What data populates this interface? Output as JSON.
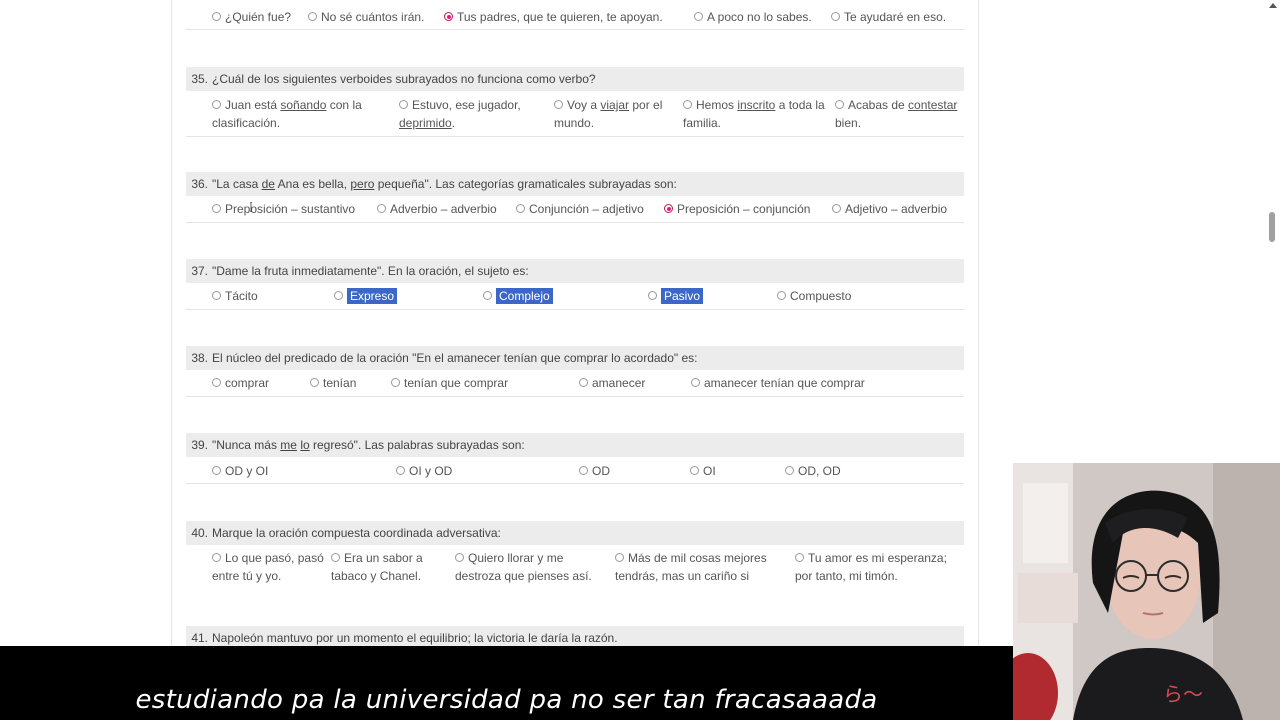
{
  "questions": [
    {
      "number": "",
      "text": "",
      "options": [
        {
          "label": "¿Quién fue?",
          "checked": false
        },
        {
          "label": "No sé cuántos irán.",
          "checked": false
        },
        {
          "label": "Tus padres, que te quieren, te apoyan.",
          "checked": true
        },
        {
          "label": "A poco no lo sabes.",
          "checked": false
        },
        {
          "label": "Te ayudaré en eso.",
          "checked": false
        }
      ]
    },
    {
      "number": "35.",
      "text": "¿Cuál de los siguientes verboides subrayados no funciona como verbo?",
      "options": [
        {
          "label_a": "Juan está ",
          "label_u": "soñando",
          "label_b": " con la",
          "label_c": "clasificación."
        },
        {
          "label_a": "Estuvo, ese jugador,",
          "label_u": "deprimido",
          "label_b": "."
        },
        {
          "label_a": "Voy a ",
          "label_u": "viajar",
          "label_b": " por el",
          "label_c": "mundo."
        },
        {
          "label_a": "Hemos ",
          "label_u": "inscrito",
          "label_b": " a toda la",
          "label_c": "familia."
        },
        {
          "label_a": "Acabas de ",
          "label_u": "contestar",
          "label_c": "bien."
        }
      ]
    },
    {
      "number": "36.",
      "text_a": "\"La casa ",
      "text_u1": "de",
      "text_b": " Ana es bella, ",
      "text_u2": "pero",
      "text_c": " pequeña\". Las categorías gramaticales subrayadas son:",
      "options": [
        {
          "label": "Preposición – sustantivo",
          "checked": false
        },
        {
          "label": "Adverbio – adverbio",
          "checked": false
        },
        {
          "label": "Conjunción – adjetivo",
          "checked": false
        },
        {
          "label": "Preposición – conjunción",
          "checked": true
        },
        {
          "label": "Adjetivo – adverbio",
          "checked": false
        }
      ]
    },
    {
      "number": "37.",
      "text": "\"Dame la fruta inmediatamente\". En la oración, el sujeto es:",
      "options": [
        {
          "label": "Tácito",
          "highlighted": false
        },
        {
          "label": "Expreso",
          "highlighted": true
        },
        {
          "label": "Complejo",
          "highlighted": true
        },
        {
          "label": "Pasivo",
          "highlighted": true
        },
        {
          "label": "Compuesto",
          "highlighted": false
        }
      ]
    },
    {
      "number": "38.",
      "text": "El núcleo del predicado de la oración \"En el amanecer tenían que comprar lo acordado\" es:",
      "options": [
        {
          "label": "comprar"
        },
        {
          "label": "tenían"
        },
        {
          "label": "tenían que comprar"
        },
        {
          "label": "amanecer"
        },
        {
          "label": "amanecer tenían que comprar"
        }
      ]
    },
    {
      "number": "39.",
      "text_a": "\"Nunca más ",
      "text_u1": "me",
      "text_b": " ",
      "text_u2": "lo",
      "text_c": " regresó\". Las palabras subrayadas son:",
      "options": [
        {
          "label": "OD y OI"
        },
        {
          "label": "OI y OD"
        },
        {
          "label": "OD"
        },
        {
          "label": "OI"
        },
        {
          "label": "OD, OD"
        }
      ]
    },
    {
      "number": "40.",
      "text": "Marque la oración compuesta coordinada adversativa:",
      "options": [
        {
          "line1": "Lo que pasó, pasó",
          "line2": "entre tú y yo."
        },
        {
          "line1": "Era un sabor a",
          "line2": "tabaco y Chanel."
        },
        {
          "line1": "Quiero llorar y me",
          "line2": "destroza que pienses así."
        },
        {
          "line1": "Más de mil cosas mejores",
          "line2": "tendrás, mas un cariño si"
        },
        {
          "line1": "Tu amor es mi esperanza;",
          "line2": "por tanto, mi timón."
        }
      ]
    },
    {
      "number": "41.",
      "text": "Napoleón mantuvo por un momento el equilibrio; la victoria le daría la razón."
    }
  ],
  "subtitle": "estudiando pa la universidad pa no ser tan fracasaaada",
  "colors": {
    "question_bg": "#ececec",
    "radio_checked": "#e0207a",
    "selection_highlight": "#3b68c8"
  }
}
